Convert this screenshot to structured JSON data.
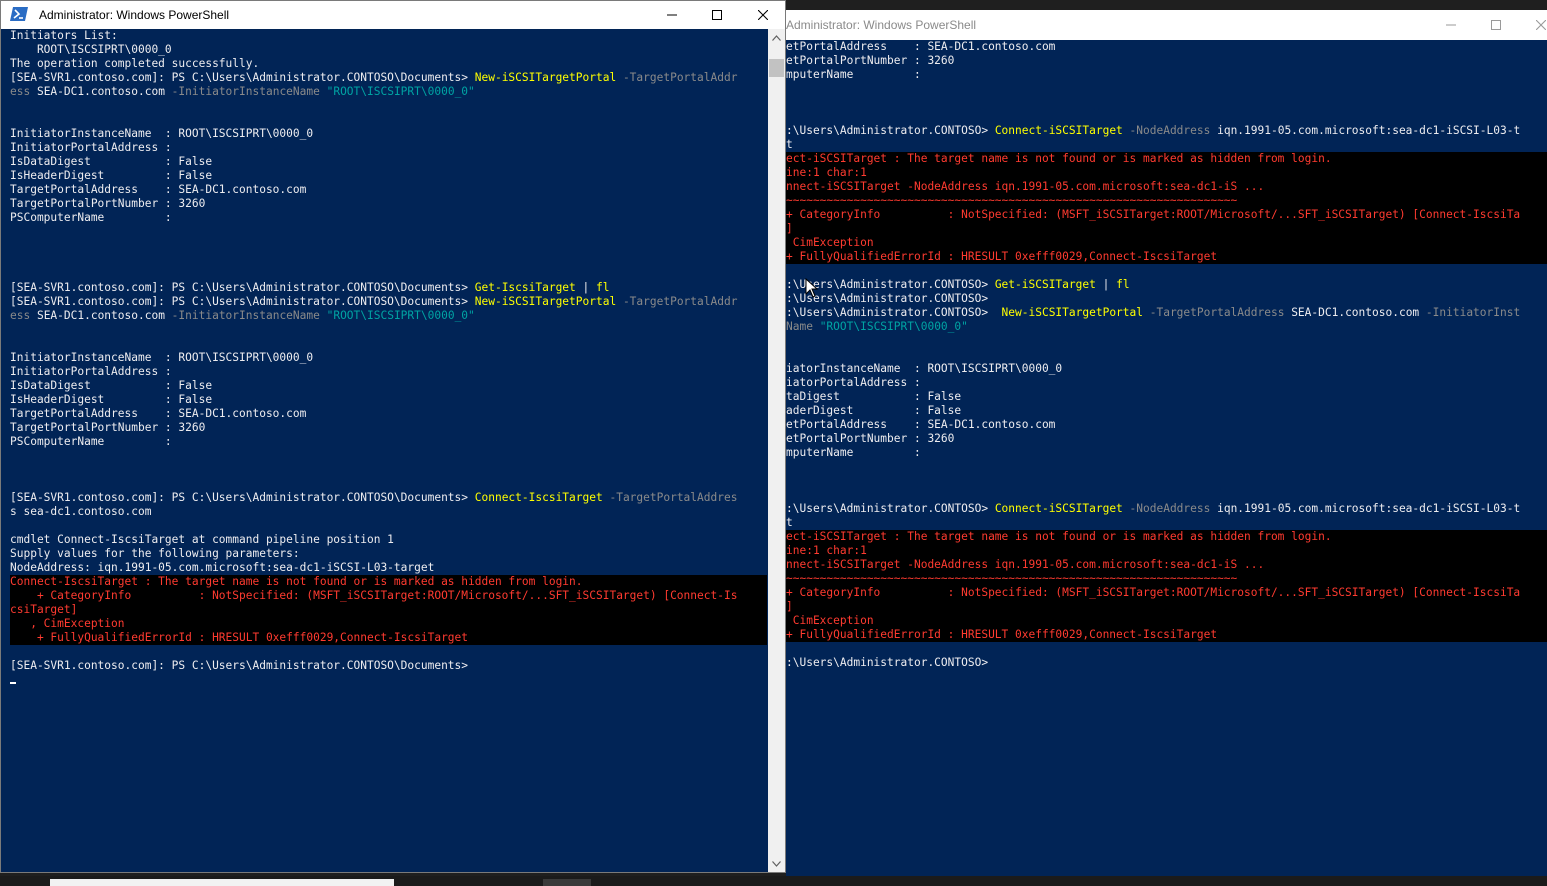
{
  "left_window": {
    "title": "Administrator: Windows PowerShell",
    "lines": [
      {
        "segments": [
          {
            "text": "Initiators List:"
          }
        ]
      },
      {
        "segments": [
          {
            "text": "    ROOT\\ISCSIPRT\\0000_0"
          }
        ]
      },
      {
        "segments": [
          {
            "text": "The operation completed successfully."
          }
        ]
      },
      {
        "segments": [
          {
            "text": "[SEA-SVR1.contoso.com]: PS C:\\Users\\Administrator.CONTOSO\\Documents> "
          },
          {
            "text": "New-iSCSITargetPortal",
            "style": "cmd"
          },
          {
            "text": " -TargetPortalAddr",
            "style": "prm"
          }
        ]
      },
      {
        "segments": [
          {
            "text": "ess",
            "style": "prm"
          },
          {
            "text": " SEA-DC1.contoso.com "
          },
          {
            "text": "-InitiatorInstanceName",
            "style": "prm"
          },
          {
            "text": " \"ROOT\\ISCSIPRT\\0000_0\"",
            "style": "str"
          }
        ]
      },
      {
        "segments": [
          {
            "text": ""
          }
        ]
      },
      {
        "segments": [
          {
            "text": ""
          }
        ]
      },
      {
        "segments": [
          {
            "text": "InitiatorInstanceName  : ROOT\\ISCSIPRT\\0000_0"
          }
        ]
      },
      {
        "segments": [
          {
            "text": "InitiatorPortalAddress :"
          }
        ]
      },
      {
        "segments": [
          {
            "text": "IsDataDigest           : False"
          }
        ]
      },
      {
        "segments": [
          {
            "text": "IsHeaderDigest         : False"
          }
        ]
      },
      {
        "segments": [
          {
            "text": "TargetPortalAddress    : SEA-DC1.contoso.com"
          }
        ]
      },
      {
        "segments": [
          {
            "text": "TargetPortalPortNumber : 3260"
          }
        ]
      },
      {
        "segments": [
          {
            "text": "PSComputerName         :"
          }
        ]
      },
      {
        "segments": [
          {
            "text": ""
          }
        ]
      },
      {
        "segments": [
          {
            "text": ""
          }
        ]
      },
      {
        "segments": [
          {
            "text": ""
          }
        ]
      },
      {
        "segments": [
          {
            "text": ""
          }
        ]
      },
      {
        "segments": [
          {
            "text": "[SEA-SVR1.contoso.com]: PS C:\\Users\\Administrator.CONTOSO\\Documents> "
          },
          {
            "text": "Get-IscsiTarget",
            "style": "cmd"
          },
          {
            "text": " | "
          },
          {
            "text": "fl",
            "style": "cmd"
          }
        ]
      },
      {
        "segments": [
          {
            "text": "[SEA-SVR1.contoso.com]: PS C:\\Users\\Administrator.CONTOSO\\Documents> "
          },
          {
            "text": "New-iSCSITargetPortal",
            "style": "cmd"
          },
          {
            "text": " -TargetPortalAddr",
            "style": "prm"
          }
        ]
      },
      {
        "segments": [
          {
            "text": "ess",
            "style": "prm"
          },
          {
            "text": " SEA-DC1.contoso.com "
          },
          {
            "text": "-InitiatorInstanceName",
            "style": "prm"
          },
          {
            "text": " \"ROOT\\ISCSIPRT\\0000_0\"",
            "style": "str"
          }
        ]
      },
      {
        "segments": [
          {
            "text": ""
          }
        ]
      },
      {
        "segments": [
          {
            "text": ""
          }
        ]
      },
      {
        "segments": [
          {
            "text": "InitiatorInstanceName  : ROOT\\ISCSIPRT\\0000_0"
          }
        ]
      },
      {
        "segments": [
          {
            "text": "InitiatorPortalAddress :"
          }
        ]
      },
      {
        "segments": [
          {
            "text": "IsDataDigest           : False"
          }
        ]
      },
      {
        "segments": [
          {
            "text": "IsHeaderDigest         : False"
          }
        ]
      },
      {
        "segments": [
          {
            "text": "TargetPortalAddress    : SEA-DC1.contoso.com"
          }
        ]
      },
      {
        "segments": [
          {
            "text": "TargetPortalPortNumber : 3260"
          }
        ]
      },
      {
        "segments": [
          {
            "text": "PSComputerName         :"
          }
        ]
      },
      {
        "segments": [
          {
            "text": ""
          }
        ]
      },
      {
        "segments": [
          {
            "text": ""
          }
        ]
      },
      {
        "segments": [
          {
            "text": ""
          }
        ]
      },
      {
        "segments": [
          {
            "text": "[SEA-SVR1.contoso.com]: PS C:\\Users\\Administrator.CONTOSO\\Documents> "
          },
          {
            "text": "Connect-IscsiTarget",
            "style": "cmd"
          },
          {
            "text": " -TargetPortalAddres",
            "style": "prm"
          }
        ]
      },
      {
        "segments": [
          {
            "text": "s sea-dc1.contoso.com"
          }
        ]
      },
      {
        "segments": [
          {
            "text": ""
          }
        ]
      },
      {
        "segments": [
          {
            "text": "cmdlet Connect-IscsiTarget at command pipeline position 1"
          }
        ]
      },
      {
        "segments": [
          {
            "text": "Supply values for the following parameters:"
          }
        ]
      },
      {
        "segments": [
          {
            "text": "NodeAddress: iqn.1991-05.com.microsoft:sea-dc1-iSCSI-L03-target"
          }
        ]
      },
      {
        "error": true,
        "segments": [
          {
            "text": "Connect-IscsiTarget : The target name is not found or is marked as hidden from login."
          }
        ]
      },
      {
        "error": true,
        "segments": [
          {
            "text": "    + CategoryInfo          : NotSpecified: (MSFT_iSCSITarget:ROOT/Microsoft/...SFT_iSCSITarget) [Connect-Is"
          }
        ]
      },
      {
        "error": true,
        "segments": [
          {
            "text": "csiTarget]"
          }
        ]
      },
      {
        "error": true,
        "segments": [
          {
            "text": "   , CimException"
          }
        ]
      },
      {
        "error": true,
        "segments": [
          {
            "text": "    + FullyQualifiedErrorId : HRESULT 0xefff0029,Connect-IscsiTarget"
          }
        ]
      },
      {
        "segments": [
          {
            "text": ""
          }
        ]
      },
      {
        "segments": [
          {
            "text": "[SEA-SVR1.contoso.com]: PS C:\\Users\\Administrator.CONTOSO\\Documents>"
          }
        ]
      }
    ]
  },
  "right_window": {
    "title": "Administrator: Windows PowerShell",
    "lines": [
      {
        "segments": [
          {
            "text": "etPortalAddress    : SEA-DC1.contoso.com"
          }
        ]
      },
      {
        "segments": [
          {
            "text": "etPortalPortNumber : 3260"
          }
        ]
      },
      {
        "segments": [
          {
            "text": "mputerName         :"
          }
        ]
      },
      {
        "segments": [
          {
            "text": ""
          }
        ]
      },
      {
        "segments": [
          {
            "text": ""
          }
        ]
      },
      {
        "segments": [
          {
            "text": ""
          }
        ]
      },
      {
        "segments": [
          {
            "text": ":\\Users\\Administrator.CONTOSO> "
          },
          {
            "text": "Connect-iSCSITarget",
            "style": "cmd"
          },
          {
            "text": " -NodeAddress",
            "style": "prm"
          },
          {
            "text": " iqn.1991-05.com.microsoft:sea-dc1-iSCSI-L03-t"
          }
        ]
      },
      {
        "segments": [
          {
            "text": "t"
          }
        ]
      },
      {
        "error": true,
        "segments": [
          {
            "text": "ect-iSCSITarget : The target name is not found or is marked as hidden from login."
          }
        ]
      },
      {
        "error": true,
        "segments": [
          {
            "text": "ine:1 char:1"
          }
        ]
      },
      {
        "error": true,
        "segments": [
          {
            "text": "nnect-iSCSITarget -NodeAddress iqn.1991-05.com.microsoft:sea-dc1-iS ..."
          }
        ]
      },
      {
        "error": true,
        "segments": [
          {
            "text": "~~~~~~~~~~~~~~~~~~~~~~~~~~~~~~~~~~~~~~~~~~~~~~~~~~~~~~~~~~~~~~~~~~~"
          }
        ]
      },
      {
        "error": true,
        "segments": [
          {
            "text": "+ CategoryInfo          : NotSpecified: (MSFT_iSCSITarget:ROOT/Microsoft/...SFT_iSCSITarget) [Connect-IscsiTa"
          }
        ]
      },
      {
        "error": true,
        "segments": [
          {
            "text": "]"
          }
        ]
      },
      {
        "error": true,
        "segments": [
          {
            "text": " CimException"
          }
        ]
      },
      {
        "error": true,
        "segments": [
          {
            "text": "+ FullyQualifiedErrorId : HRESULT 0xefff0029,Connect-IscsiTarget"
          }
        ]
      },
      {
        "segments": [
          {
            "text": ""
          }
        ]
      },
      {
        "segments": [
          {
            "text": ":\\Users\\Administrator.CONTOSO> "
          },
          {
            "text": "Get-iSCSITarget",
            "style": "cmd"
          },
          {
            "text": " | "
          },
          {
            "text": "fl",
            "style": "cmd"
          }
        ]
      },
      {
        "segments": [
          {
            "text": ":\\Users\\Administrator.CONTOSO>"
          }
        ]
      },
      {
        "segments": [
          {
            "text": ":\\Users\\Administrator.CONTOSO>  "
          },
          {
            "text": "New-iSCSITargetPortal",
            "style": "cmd"
          },
          {
            "text": " -TargetPortalAddress",
            "style": "prm"
          },
          {
            "text": " SEA-DC1.contoso.com "
          },
          {
            "text": "-InitiatorInst",
            "style": "prm"
          }
        ]
      },
      {
        "segments": [
          {
            "text": "Name",
            "style": "prm"
          },
          {
            "text": " \"ROOT\\ISCSIPRT\\0000_0\"",
            "style": "str"
          }
        ]
      },
      {
        "segments": [
          {
            "text": ""
          }
        ]
      },
      {
        "segments": [
          {
            "text": ""
          }
        ]
      },
      {
        "segments": [
          {
            "text": "iatorInstanceName  : ROOT\\ISCSIPRT\\0000_0"
          }
        ]
      },
      {
        "segments": [
          {
            "text": "iatorPortalAddress :"
          }
        ]
      },
      {
        "segments": [
          {
            "text": "taDigest           : False"
          }
        ]
      },
      {
        "segments": [
          {
            "text": "aderDigest         : False"
          }
        ]
      },
      {
        "segments": [
          {
            "text": "etPortalAddress    : SEA-DC1.contoso.com"
          }
        ]
      },
      {
        "segments": [
          {
            "text": "etPortalPortNumber : 3260"
          }
        ]
      },
      {
        "segments": [
          {
            "text": "mputerName         :"
          }
        ]
      },
      {
        "segments": [
          {
            "text": ""
          }
        ]
      },
      {
        "segments": [
          {
            "text": ""
          }
        ]
      },
      {
        "segments": [
          {
            "text": ""
          }
        ]
      },
      {
        "segments": [
          {
            "text": ":\\Users\\Administrator.CONTOSO> "
          },
          {
            "text": "Connect-iSCSITarget",
            "style": "cmd"
          },
          {
            "text": " -NodeAddress",
            "style": "prm"
          },
          {
            "text": " iqn.1991-05.com.microsoft:sea-dc1-iSCSI-L03-t"
          }
        ]
      },
      {
        "segments": [
          {
            "text": "t"
          }
        ]
      },
      {
        "error": true,
        "segments": [
          {
            "text": "ect-iSCSITarget : The target name is not found or is marked as hidden from login."
          }
        ]
      },
      {
        "error": true,
        "segments": [
          {
            "text": "ine:1 char:1"
          }
        ]
      },
      {
        "error": true,
        "segments": [
          {
            "text": "nnect-iSCSITarget -NodeAddress iqn.1991-05.com.microsoft:sea-dc1-iS ..."
          }
        ]
      },
      {
        "error": true,
        "segments": [
          {
            "text": "~~~~~~~~~~~~~~~~~~~~~~~~~~~~~~~~~~~~~~~~~~~~~~~~~~~~~~~~~~~~~~~~~~~"
          }
        ]
      },
      {
        "error": true,
        "segments": [
          {
            "text": "+ CategoryInfo          : NotSpecified: (MSFT_iSCSITarget:ROOT/Microsoft/...SFT_iSCSITarget) [Connect-IscsiTa"
          }
        ]
      },
      {
        "error": true,
        "segments": [
          {
            "text": "]"
          }
        ]
      },
      {
        "error": true,
        "segments": [
          {
            "text": " CimException"
          }
        ]
      },
      {
        "error": true,
        "segments": [
          {
            "text": "+ FullyQualifiedErrorId : HRESULT 0xefff0029,Connect-IscsiTarget"
          }
        ]
      },
      {
        "segments": [
          {
            "text": ""
          }
        ]
      },
      {
        "segments": [
          {
            "text": ":\\Users\\Administrator.CONTOSO>"
          }
        ]
      }
    ]
  },
  "icons": {
    "powershell": "powershell-icon",
    "minimize": "minimize-icon",
    "maximize": "maximize-icon",
    "close": "close-icon",
    "scroll_up": "scroll-up-arrow-icon",
    "scroll_down": "scroll-down-arrow-icon",
    "cursor": "mouse-pointer-icon"
  },
  "colors": {
    "console_bg": "#012456",
    "console_fg": "#eeedf0",
    "command": "#ffff00",
    "parameter": "#8a8a8a",
    "string": "#00a3a3",
    "error_fg": "#ff3b30",
    "error_bg": "#000000"
  }
}
